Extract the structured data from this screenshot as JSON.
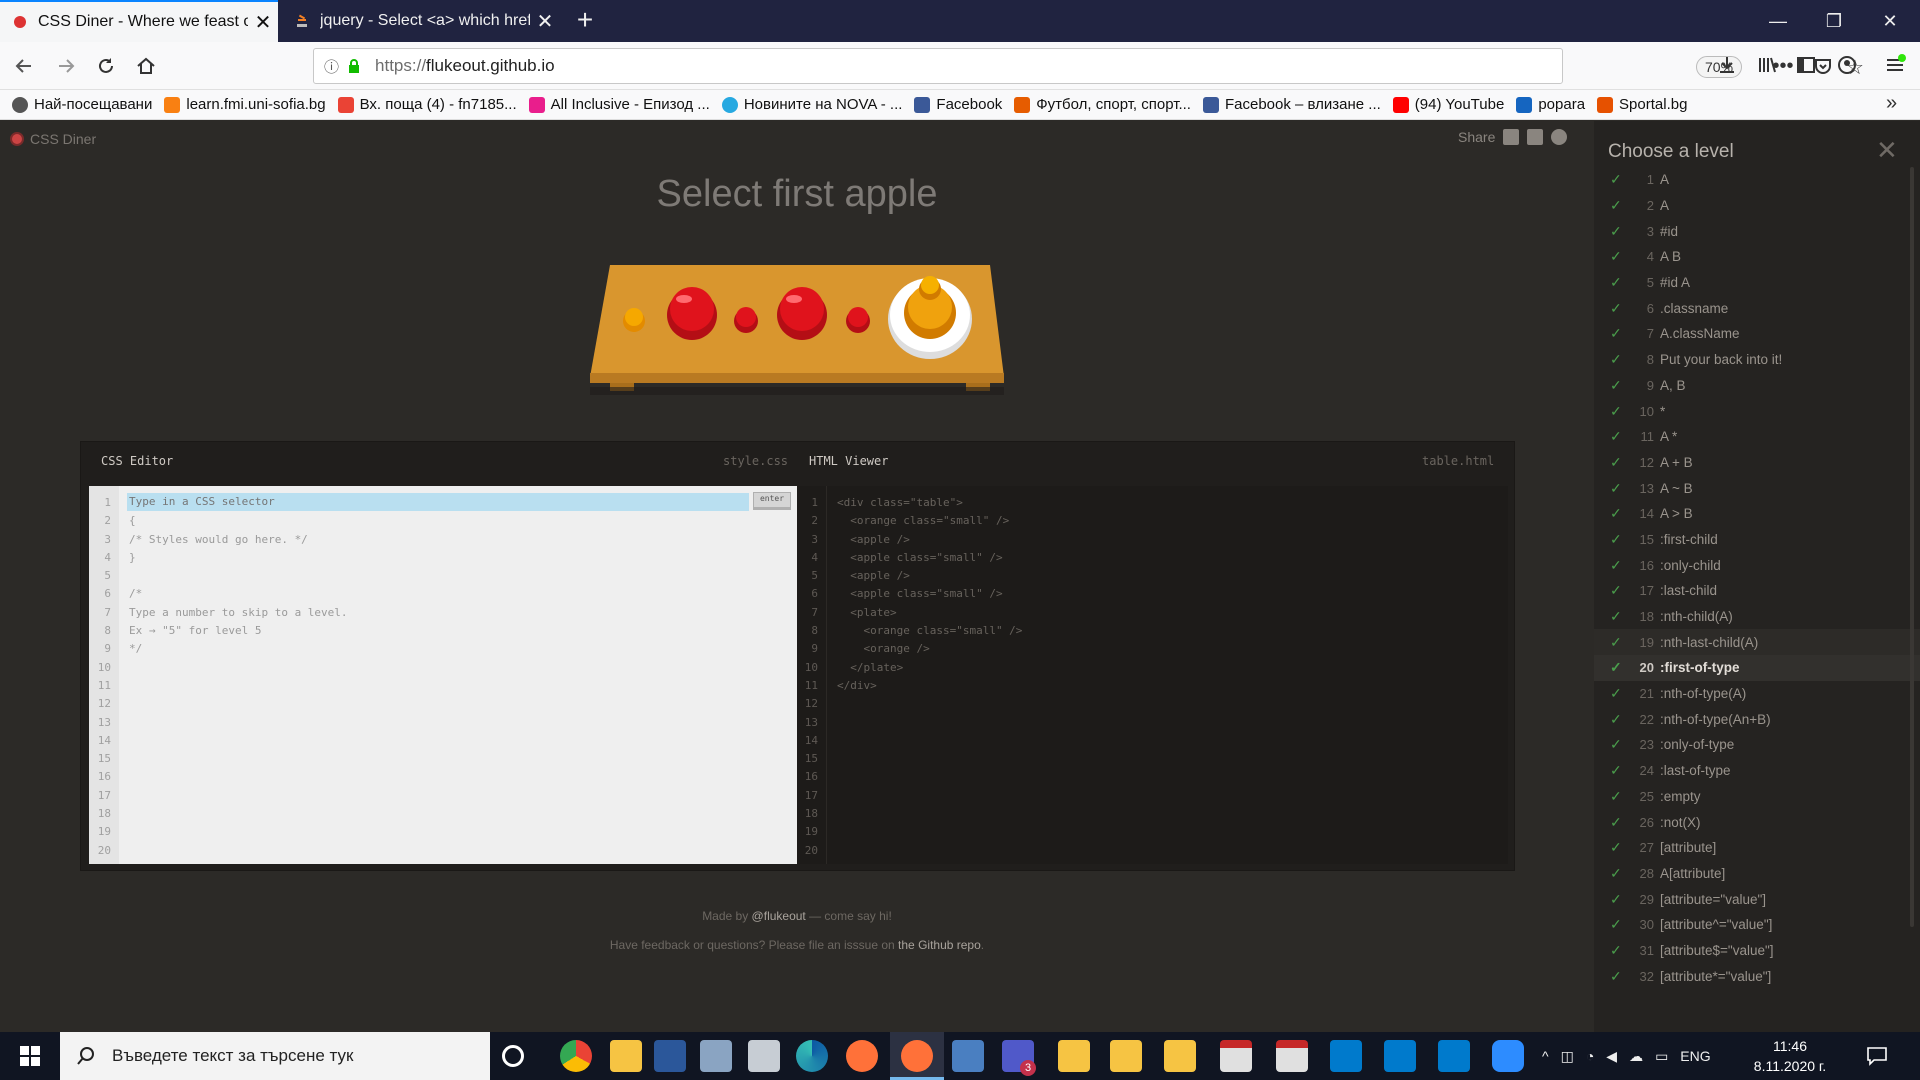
{
  "browser": {
    "tabs": [
      {
        "title": "CSS Diner - Where we feast on",
        "active": true,
        "favicon": "csdiner-dot-icon"
      },
      {
        "title": "jquery - Select <a> which href",
        "active": false,
        "favicon": "stackoverflow-icon"
      }
    ],
    "url_protocol": "https://",
    "url_host": "flukeout.github.io",
    "zoom": "70%",
    "bookmarks": [
      {
        "label": "Най-посещавани",
        "icon": "gear-icon"
      },
      {
        "label": "learn.fmi.uni-sofia.bg",
        "icon": "moodle-icon"
      },
      {
        "label": "Вх. поща (4) - fn7185...",
        "icon": "gmail-icon"
      },
      {
        "label": "All Inclusive - Епизод ...",
        "icon": "channel-icon"
      },
      {
        "label": "Новините на NOVA - ...",
        "icon": "nova-icon"
      },
      {
        "label": "Facebook",
        "icon": "facebook-icon"
      },
      {
        "label": "Футбол, спорт, спорт...",
        "icon": "sport-icon"
      },
      {
        "label": "Facebook – влизане ...",
        "icon": "facebook-icon"
      },
      {
        "label": "(94) YouTube",
        "icon": "youtube-icon"
      },
      {
        "label": "popara",
        "icon": "bird-icon"
      },
      {
        "label": "Sportal.bg",
        "icon": "sportal-icon"
      }
    ]
  },
  "page": {
    "logo": "CSS Diner",
    "share_label": "Share",
    "order": "Select first apple",
    "css_editor": {
      "title": "CSS Editor",
      "file": "style.css",
      "placeholder": "Type in a CSS selector",
      "enter_label": "enter",
      "code": "{\n/* Styles would go here. */\n}\n\n/*\nType a number to skip to a level.\nEx → \"5\" for level 5\n*/",
      "line_numbers": "1\n2\n3\n4\n5\n6\n7\n8\n9\n10\n11\n12\n13\n14\n15\n16\n17\n18\n19\n20"
    },
    "html_viewer": {
      "title": "HTML Viewer",
      "file": "table.html",
      "code": "<div class=\"table\">\n  <orange class=\"small\" />\n  <apple />\n  <apple class=\"small\" />\n  <apple />\n  <apple class=\"small\" />\n  <plate>\n    <orange class=\"small\" />\n    <orange />\n  </plate>\n</div>",
      "line_numbers": "1\n2\n3\n4\n5\n6\n7\n8\n9\n10\n11\n12\n13\n14\n15\n16\n17\n18\n19\n20"
    },
    "footer_line1_prefix": "Made by ",
    "footer_author": "@flukeout",
    "footer_line1_suffix": " — come say hi!",
    "footer_line2_prefix": "Have feedback or questions? Please file an isssue on ",
    "footer_repo": "the Github repo",
    "footer_line2_suffix": "."
  },
  "sidebar": {
    "title": "Choose a level",
    "levels": [
      {
        "num": "1",
        "label": "A"
      },
      {
        "num": "2",
        "label": "A"
      },
      {
        "num": "3",
        "label": "#id"
      },
      {
        "num": "4",
        "label": "A B"
      },
      {
        "num": "5",
        "label": "#id  A"
      },
      {
        "num": "6",
        "label": ".classname"
      },
      {
        "num": "7",
        "label": "A.className"
      },
      {
        "num": "8",
        "label": "Put your back into it!"
      },
      {
        "num": "9",
        "label": "A, B"
      },
      {
        "num": "10",
        "label": "*"
      },
      {
        "num": "11",
        "label": "A  *"
      },
      {
        "num": "12",
        "label": "A + B"
      },
      {
        "num": "13",
        "label": "A ~ B"
      },
      {
        "num": "14",
        "label": "A > B"
      },
      {
        "num": "15",
        "label": ":first-child"
      },
      {
        "num": "16",
        "label": ":only-child"
      },
      {
        "num": "17",
        "label": ":last-child"
      },
      {
        "num": "18",
        "label": ":nth-child(A)"
      },
      {
        "num": "19",
        "label": ":nth-last-child(A)"
      },
      {
        "num": "20",
        "label": ":first-of-type"
      },
      {
        "num": "21",
        "label": ":nth-of-type(A)"
      },
      {
        "num": "22",
        "label": ":nth-of-type(An+B)"
      },
      {
        "num": "23",
        "label": ":only-of-type"
      },
      {
        "num": "24",
        "label": ":last-of-type"
      },
      {
        "num": "25",
        "label": ":empty"
      },
      {
        "num": "26",
        "label": ":not(X)"
      },
      {
        "num": "27",
        "label": "[attribute]"
      },
      {
        "num": "28",
        "label": "A[attribute]"
      },
      {
        "num": "29",
        "label": "[attribute=\"value\"]"
      },
      {
        "num": "30",
        "label": "[attribute^=\"value\"]"
      },
      {
        "num": "31",
        "label": "[attribute$=\"value\"]"
      },
      {
        "num": "32",
        "label": "[attribute*=\"value\"]"
      }
    ],
    "current_level": "20"
  },
  "taskbar": {
    "search_placeholder": "Въведете текст за търсене тук",
    "language": "ENG",
    "time": "11:46",
    "date": "8.11.2020 г.",
    "teams_badge": "3"
  },
  "colors": {
    "background": "#2c2a27",
    "check": "#4a9d4c",
    "apple": "#e0131c",
    "orange": "#f0a20d",
    "table": "#d9962e"
  }
}
